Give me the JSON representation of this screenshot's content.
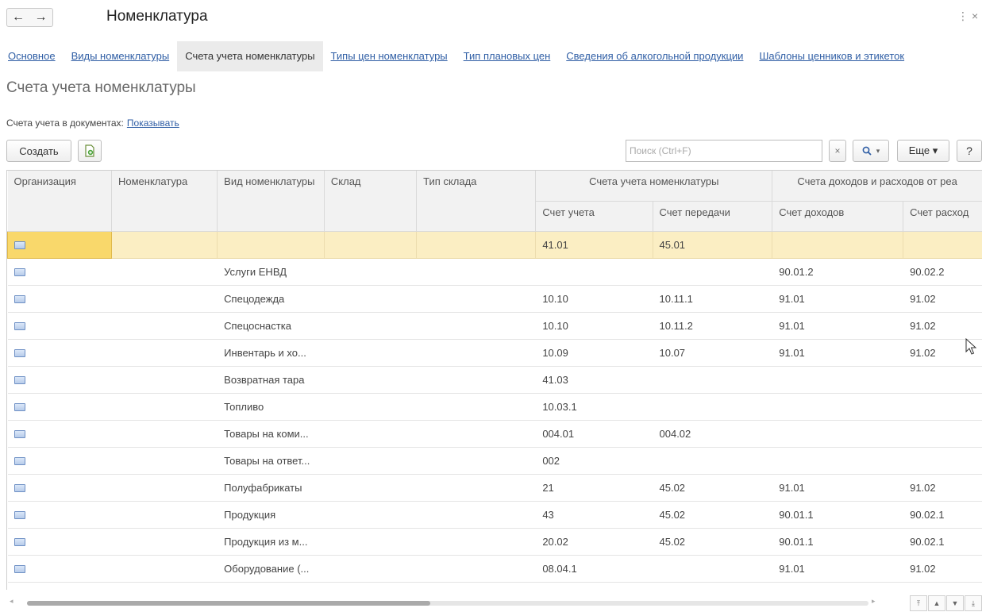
{
  "window": {
    "title": "Номенклатура",
    "back_icon": "←",
    "forward_icon": "→",
    "more_icon": "⋮",
    "close_icon": "×"
  },
  "tabs": [
    {
      "label": "Основное",
      "active": false
    },
    {
      "label": "Виды номенклатуры",
      "active": false
    },
    {
      "label": "Счета учета номенклатуры",
      "active": true
    },
    {
      "label": "Типы цен номенклатуры",
      "active": false
    },
    {
      "label": "Тип плановых цен",
      "active": false
    },
    {
      "label": "Сведения об алкогольной продукции",
      "active": false
    },
    {
      "label": "Шаблоны ценников и этикеток",
      "active": false
    }
  ],
  "section": {
    "title": "Счета учета номенклатуры",
    "doc_label": "Счета учета в документах:",
    "doc_link": "Показывать"
  },
  "toolbar": {
    "create_label": "Создать",
    "search_placeholder": "Поиск (Ctrl+F)",
    "clear_icon": "×",
    "search_icon": "🔍▾",
    "more_label": "Еще ▾",
    "help_label": "?"
  },
  "table": {
    "headers": {
      "org": "Организация",
      "nom": "Номенклатура",
      "kind": "Вид номенклатуры",
      "warehouse": "Склад",
      "warehouse_type": "Тип склада",
      "group_accounts": "Счета учета номенклатуры",
      "account": "Счет учета",
      "transfer": "Счет передачи",
      "group_income": "Счета доходов и расходов от реа",
      "income": "Счет доходов",
      "expense": "Счет расход"
    },
    "rows": [
      {
        "kind": "",
        "account": "41.01",
        "transfer": "45.01",
        "income": "",
        "expense": "",
        "selected": true
      },
      {
        "kind": "Услуги ЕНВД",
        "account": "",
        "transfer": "",
        "income": "90.01.2",
        "expense": "90.02.2"
      },
      {
        "kind": "Спецодежда",
        "account": "10.10",
        "transfer": "10.11.1",
        "income": "91.01",
        "expense": "91.02"
      },
      {
        "kind": "Спецоснастка",
        "account": "10.10",
        "transfer": "10.11.2",
        "income": "91.01",
        "expense": "91.02"
      },
      {
        "kind": "Инвентарь и хо...",
        "account": "10.09",
        "transfer": "10.07",
        "income": "91.01",
        "expense": "91.02"
      },
      {
        "kind": "Возвратная тара",
        "account": "41.03",
        "transfer": "",
        "income": "",
        "expense": ""
      },
      {
        "kind": "Топливо",
        "account": "10.03.1",
        "transfer": "",
        "income": "",
        "expense": ""
      },
      {
        "kind": "Товары на коми...",
        "account": "004.01",
        "transfer": "004.02",
        "income": "",
        "expense": ""
      },
      {
        "kind": "Товары на ответ...",
        "account": "002",
        "transfer": "",
        "income": "",
        "expense": ""
      },
      {
        "kind": "Полуфабрикаты",
        "account": "21",
        "transfer": "45.02",
        "income": "91.01",
        "expense": "91.02"
      },
      {
        "kind": "Продукция",
        "account": "43",
        "transfer": "45.02",
        "income": "90.01.1",
        "expense": "90.02.1"
      },
      {
        "kind": "Продукция из м...",
        "account": "20.02",
        "transfer": "45.02",
        "income": "90.01.1",
        "expense": "90.02.1"
      },
      {
        "kind": "Оборудование (...",
        "account": "08.04.1",
        "transfer": "",
        "income": "91.01",
        "expense": "91.02"
      }
    ]
  },
  "colors": {
    "link": "#2f5ea5",
    "selected_row": "#fbeec3",
    "selected_cell": "#f9d86b"
  }
}
